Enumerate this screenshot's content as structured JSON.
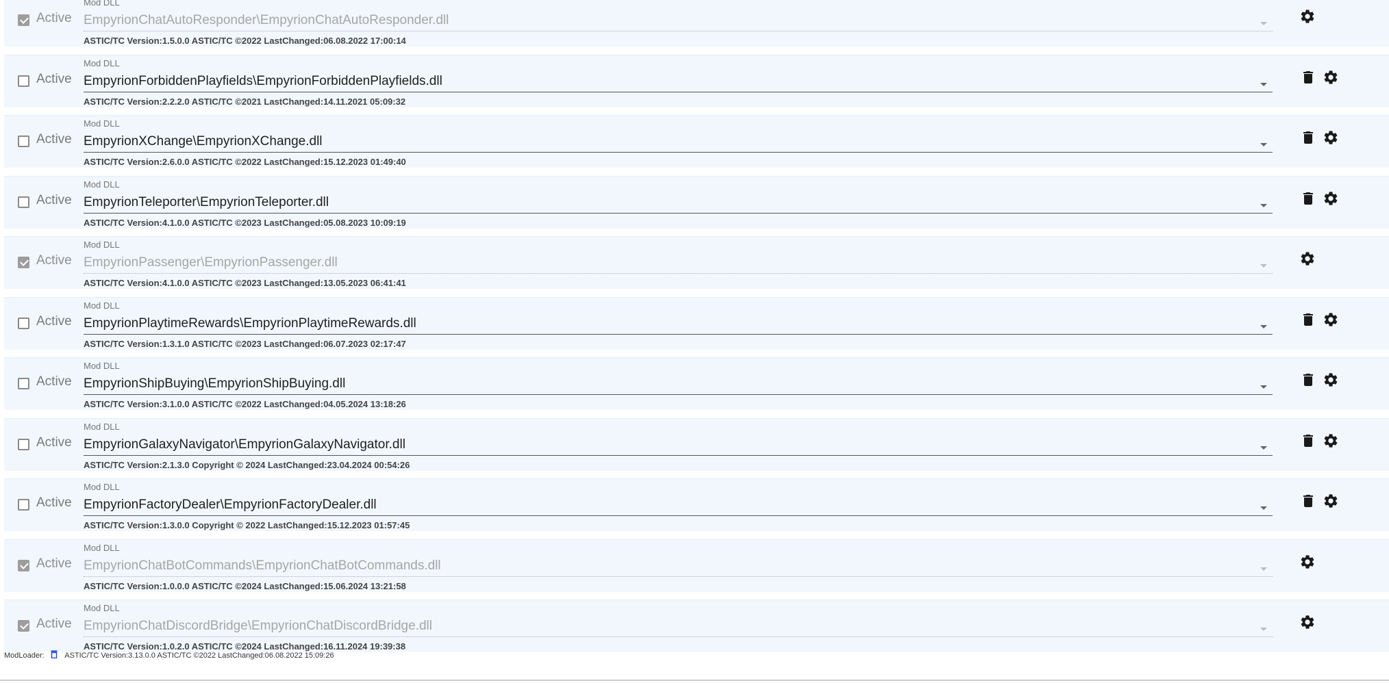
{
  "active_label": "Active",
  "mod_dll_label": "Mod DLL",
  "mods": [
    {
      "enabled": true,
      "path": "EmpyrionChatAutoResponder\\EmpyrionChatAutoResponder.dll",
      "info": "ASTIC/TC Version:1.5.0.0 ASTIC/TC ©2022 LastChanged:06.08.2022 17:00:14",
      "deletable": false
    },
    {
      "enabled": false,
      "path": "EmpyrionForbiddenPlayfields\\EmpyrionForbiddenPlayfields.dll",
      "info": "ASTIC/TC Version:2.2.2.0 ASTIC/TC ©2021 LastChanged:14.11.2021 05:09:32",
      "deletable": true
    },
    {
      "enabled": false,
      "path": "EmpyrionXChange\\EmpyrionXChange.dll",
      "info": "ASTIC/TC Version:2.6.0.0 ASTIC/TC ©2022 LastChanged:15.12.2023 01:49:40",
      "deletable": true
    },
    {
      "enabled": false,
      "path": "EmpyrionTeleporter\\EmpyrionTeleporter.dll",
      "info": "ASTIC/TC Version:4.1.0.0 ASTIC/TC ©2023 LastChanged:05.08.2023 10:09:19",
      "deletable": true
    },
    {
      "enabled": true,
      "path": "EmpyrionPassenger\\EmpyrionPassenger.dll",
      "info": "ASTIC/TC Version:4.1.0.0 ASTIC/TC ©2023 LastChanged:13.05.2023 06:41:41",
      "deletable": false
    },
    {
      "enabled": false,
      "path": "EmpyrionPlaytimeRewards\\EmpyrionPlaytimeRewards.dll",
      "info": "ASTIC/TC Version:1.3.1.0 ASTIC/TC ©2023 LastChanged:06.07.2023 02:17:47",
      "deletable": true
    },
    {
      "enabled": false,
      "path": "EmpyrionShipBuying\\EmpyrionShipBuying.dll",
      "info": "ASTIC/TC Version:3.1.0.0 ASTIC/TC ©2022 LastChanged:04.05.2024 13:18:26",
      "deletable": true
    },
    {
      "enabled": false,
      "path": "EmpyrionGalaxyNavigator\\EmpyrionGalaxyNavigator.dll",
      "info": "ASTIC/TC Version:2.1.3.0 Copyright © 2024 LastChanged:23.04.2024 00:54:26",
      "deletable": true
    },
    {
      "enabled": false,
      "path": "EmpyrionFactoryDealer\\EmpyrionFactoryDealer.dll",
      "info": "ASTIC/TC Version:1.3.0.0 Copyright © 2022 LastChanged:15.12.2023 01:57:45",
      "deletable": true
    },
    {
      "enabled": true,
      "path": "EmpyrionChatBotCommands\\EmpyrionChatBotCommands.dll",
      "info": "ASTIC/TC Version:1.0.0.0 ASTIC/TC ©2024 LastChanged:15.06.2024 13:21:58",
      "deletable": false
    },
    {
      "enabled": true,
      "path": "EmpyrionChatDiscordBridge\\EmpyrionChatDiscordBridge.dll",
      "info": "ASTIC/TC Version:1.0.2.0 ASTIC/TC ©2024 LastChanged:16.11.2024 19:39:38",
      "deletable": false
    }
  ],
  "footer": {
    "label": "ModLoader:",
    "icon": "modloader-icon",
    "info": "ASTIC/TC Version:3.13.0.0 ASTIC/TC ©2022 LastChanged:06.08.2022 15:09:26"
  },
  "icons": {
    "delete": "trash-icon",
    "settings": "gear-icon"
  },
  "colors": {
    "row_background": "#f1f7fd",
    "icon": "#1a1a1a",
    "modloader_icon": "#1a3fd6"
  }
}
